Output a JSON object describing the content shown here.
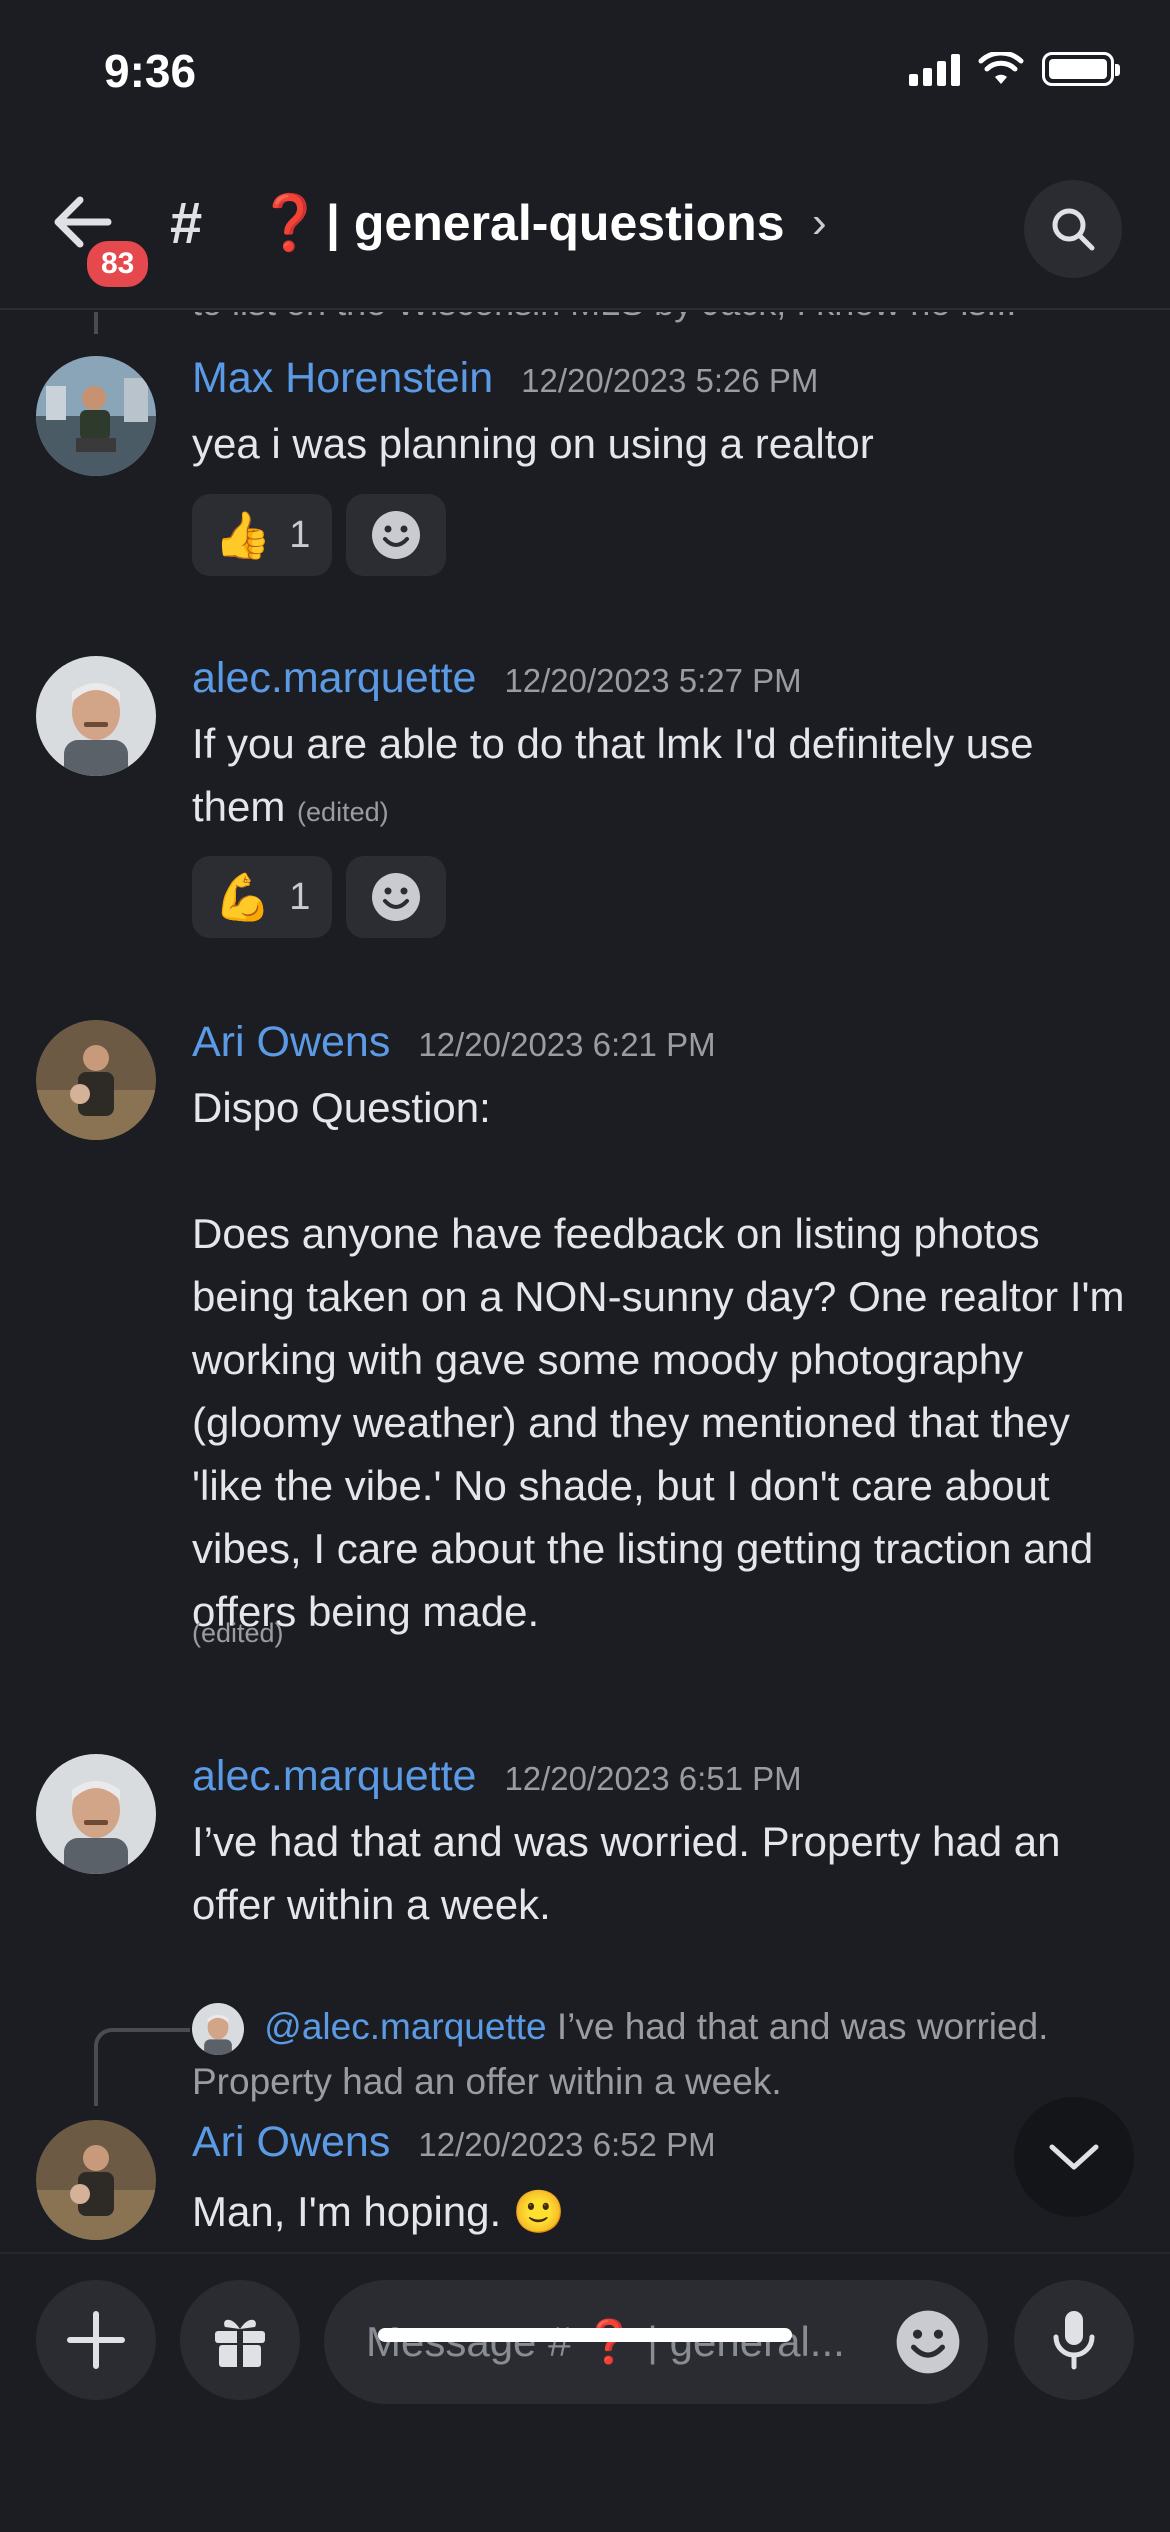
{
  "status_bar": {
    "time": "9:36"
  },
  "header": {
    "unread_badge": "83",
    "channel_hash": "#",
    "channel_emoji": "❓",
    "channel_name": "| general-questions",
    "chevron": "›"
  },
  "cutoff_text": "to list on the Wisconsin MLS by Jack, I know he is...",
  "messages": [
    {
      "author": "Max Horenstein",
      "timestamp": "12/20/2023 5:26 PM",
      "text": "yea i was planning on using a realtor",
      "reactions": [
        {
          "emoji": "👍",
          "count": "1"
        }
      ]
    },
    {
      "author": "alec.marquette",
      "timestamp": "12/20/2023 5:27 PM",
      "text": "If you are able to do that lmk I'd definitely use them",
      "edited": "(edited)",
      "reactions": [
        {
          "emoji": "💪",
          "count": "1"
        }
      ]
    },
    {
      "author": "Ari Owens",
      "timestamp": "12/20/2023 6:21 PM",
      "text_line1": "Dispo Question:",
      "text_para": "Does anyone have feedback on listing photos being taken on a NON-sunny day? One realtor I'm working with gave some moody photography (gloomy weather) and they mentioned that they 'like the vibe.'  No shade, but I don't care about vibes, I care about the listing getting traction and offers being made.",
      "edited": "(edited)"
    },
    {
      "author": "alec.marquette",
      "timestamp": "12/20/2023 6:51 PM",
      "text": "I’ve had that and was worried. Property had an offer within a week."
    },
    {
      "reply_mention": "@alec.marquette",
      "reply_text": "I’ve had that and was worried. Property had an offer within a week.",
      "author": "Ari Owens",
      "timestamp": "12/20/2023 6:52 PM",
      "text": "Man, I'm hoping. 🙂"
    }
  ],
  "composer": {
    "placeholder": "Message # ❓ | general..."
  },
  "colors": {
    "background": "#1c1d22",
    "author": "#5b9be6",
    "badge": "#e5484d"
  },
  "icons": [
    "back-arrow-icon",
    "search-icon",
    "add-reaction-icon",
    "plus-icon",
    "gift-icon",
    "emoji-icon",
    "microphone-icon",
    "chevron-down-icon"
  ]
}
